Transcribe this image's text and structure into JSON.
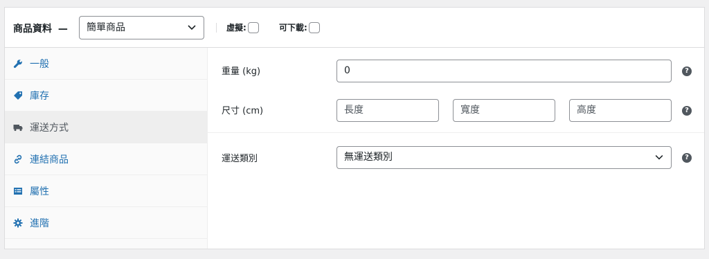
{
  "header": {
    "title": "商品資料",
    "dash": "—",
    "product_type": "簡單商品",
    "virtual_label": "虛擬:",
    "downloadable_label": "可下載:"
  },
  "tabs": [
    {
      "label": "一般",
      "icon": "wrench-icon"
    },
    {
      "label": "庫存",
      "icon": "tag-icon"
    },
    {
      "label": "運送方式",
      "icon": "truck-icon",
      "active": true
    },
    {
      "label": "連結商品",
      "icon": "link-icon"
    },
    {
      "label": "屬性",
      "icon": "list-icon"
    },
    {
      "label": "進階",
      "icon": "gear-icon"
    }
  ],
  "shipping": {
    "weight_label": "重量 (kg)",
    "weight_value": "0",
    "dimensions_label": "尺寸 (cm)",
    "length_placeholder": "長度",
    "width_placeholder": "寬度",
    "height_placeholder": "高度",
    "class_label": "運送類別",
    "class_value": "無運送類別",
    "help_glyph": "?"
  }
}
